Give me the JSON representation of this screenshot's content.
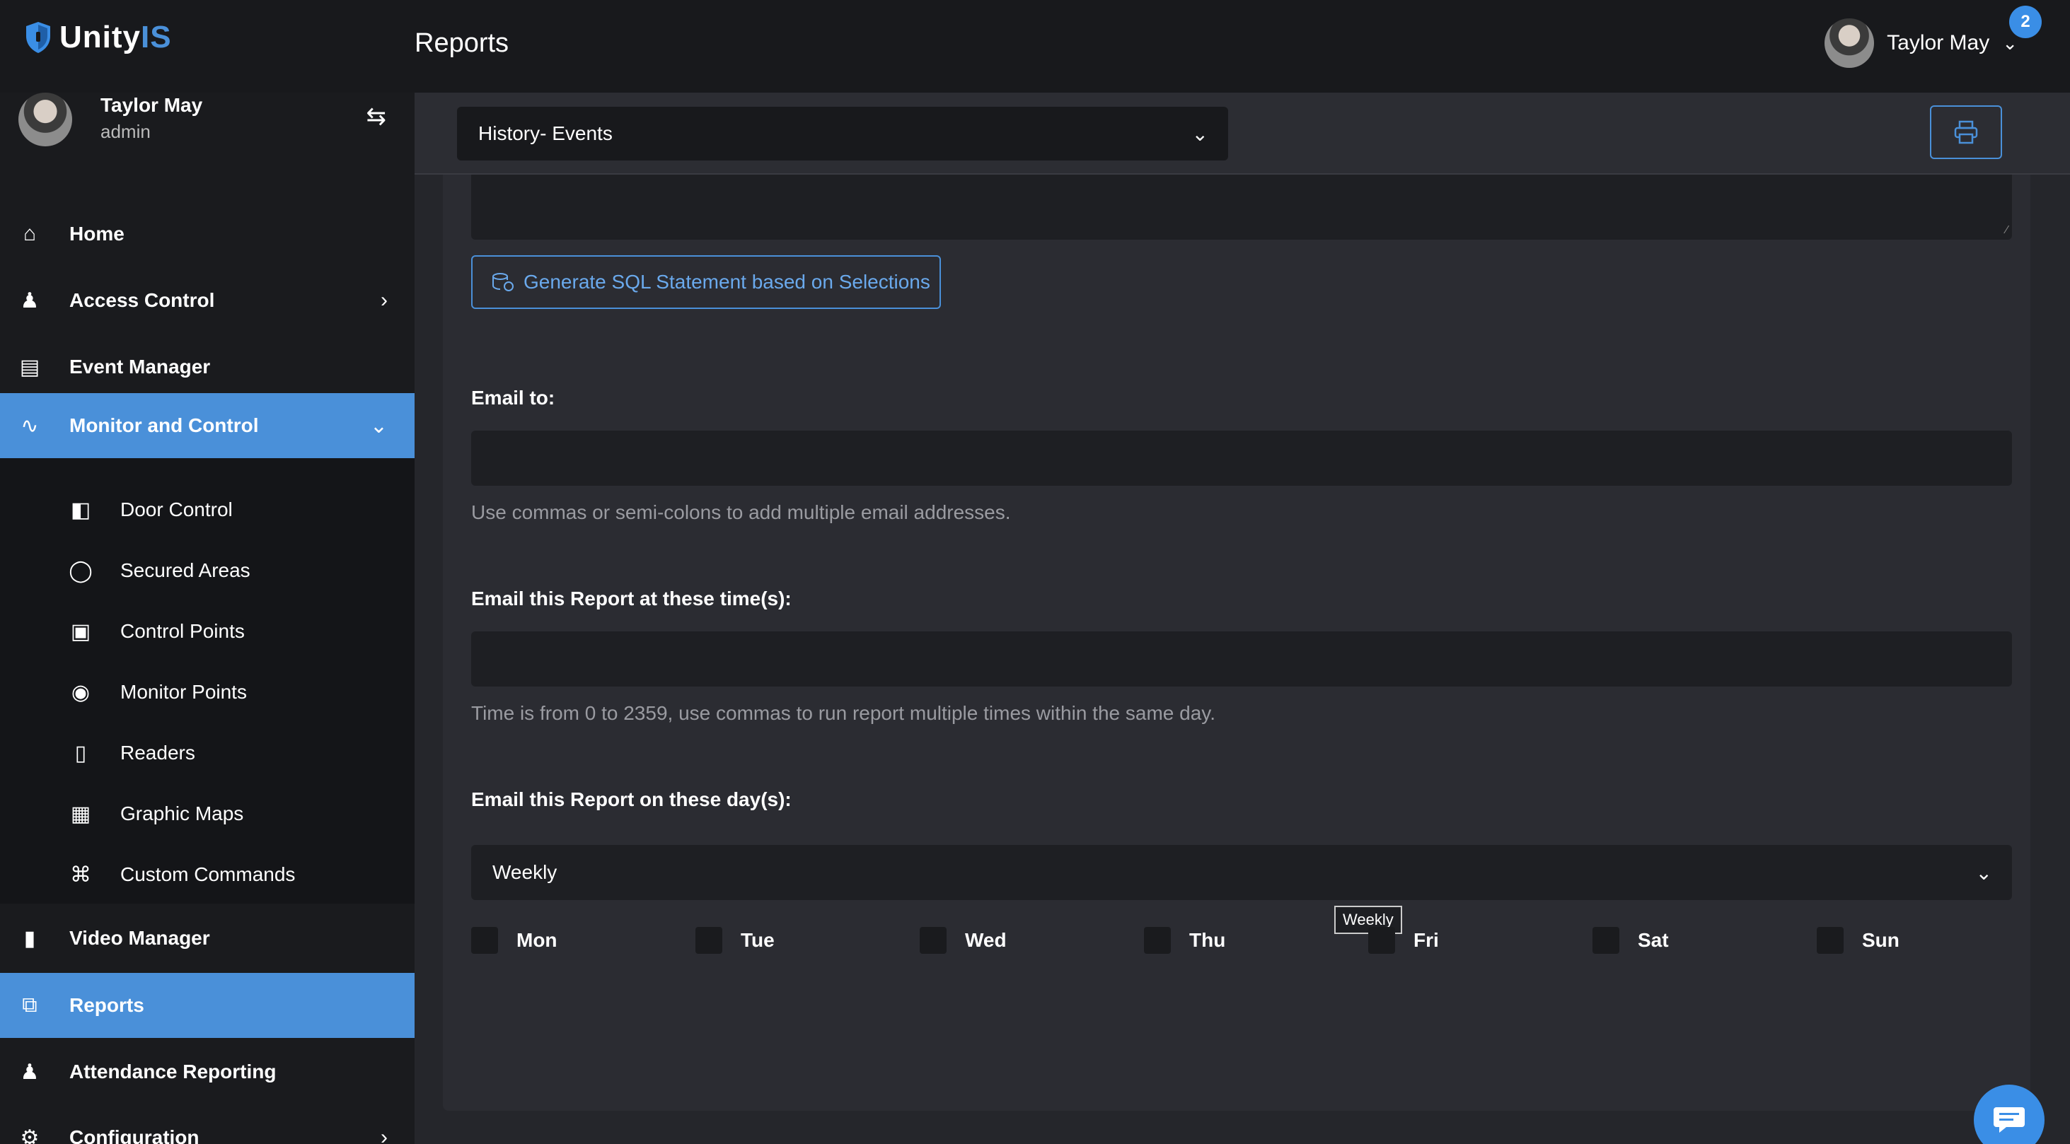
{
  "brand": {
    "name_main": "Unity",
    "name_accent": "IS"
  },
  "header": {
    "title": "Reports",
    "user_name": "Taylor May",
    "notification_count": "2"
  },
  "sidebar": {
    "user": {
      "name": "Taylor May",
      "role": "admin"
    },
    "items": [
      {
        "label": "Home",
        "icon": "home-icon"
      },
      {
        "label": "Access Control",
        "icon": "user-lock-icon"
      },
      {
        "label": "Event Manager",
        "icon": "newspaper-icon"
      },
      {
        "label": "Monitor and Control",
        "icon": "heartbeat-icon"
      },
      {
        "label": "Video Manager",
        "icon": "video-icon"
      },
      {
        "label": "Reports",
        "icon": "copy-icon"
      },
      {
        "label": "Attendance Reporting",
        "icon": "user-check-icon"
      },
      {
        "label": "Configuration",
        "icon": "gear-icon"
      }
    ],
    "submenu": [
      {
        "label": "Door Control",
        "icon": "door-icon"
      },
      {
        "label": "Secured Areas",
        "icon": "shield-icon"
      },
      {
        "label": "Control Points",
        "icon": "control-panel-icon"
      },
      {
        "label": "Monitor Points",
        "icon": "dot-circle-icon"
      },
      {
        "label": "Readers",
        "icon": "tablet-icon"
      },
      {
        "label": "Graphic Maps",
        "icon": "building-icon"
      },
      {
        "label": "Custom Commands",
        "icon": "command-icon"
      }
    ]
  },
  "toolbar": {
    "report_type": "History- Events"
  },
  "form": {
    "generate_sql_label": "Generate SQL Statement based on Selections",
    "email_to_label": "Email to:",
    "email_to_value": "",
    "email_to_help": "Use commas or semi-colons to add multiple email addresses.",
    "email_times_label": "Email this Report at these time(s):",
    "email_times_value": "",
    "email_times_help": "Time is from 0 to 2359, use commas to run report multiple times within the same day.",
    "email_days_label": "Email this Report on these day(s):",
    "email_days_selected": "Weekly",
    "tooltip": "Weekly",
    "days": [
      "Mon",
      "Tue",
      "Wed",
      "Thu",
      "Fri",
      "Sat",
      "Sun"
    ]
  },
  "colors": {
    "accent": "#4a90d9",
    "topbar": "#18191c",
    "sidebar": "#1a1b1e",
    "panel": "#2b2c32"
  }
}
